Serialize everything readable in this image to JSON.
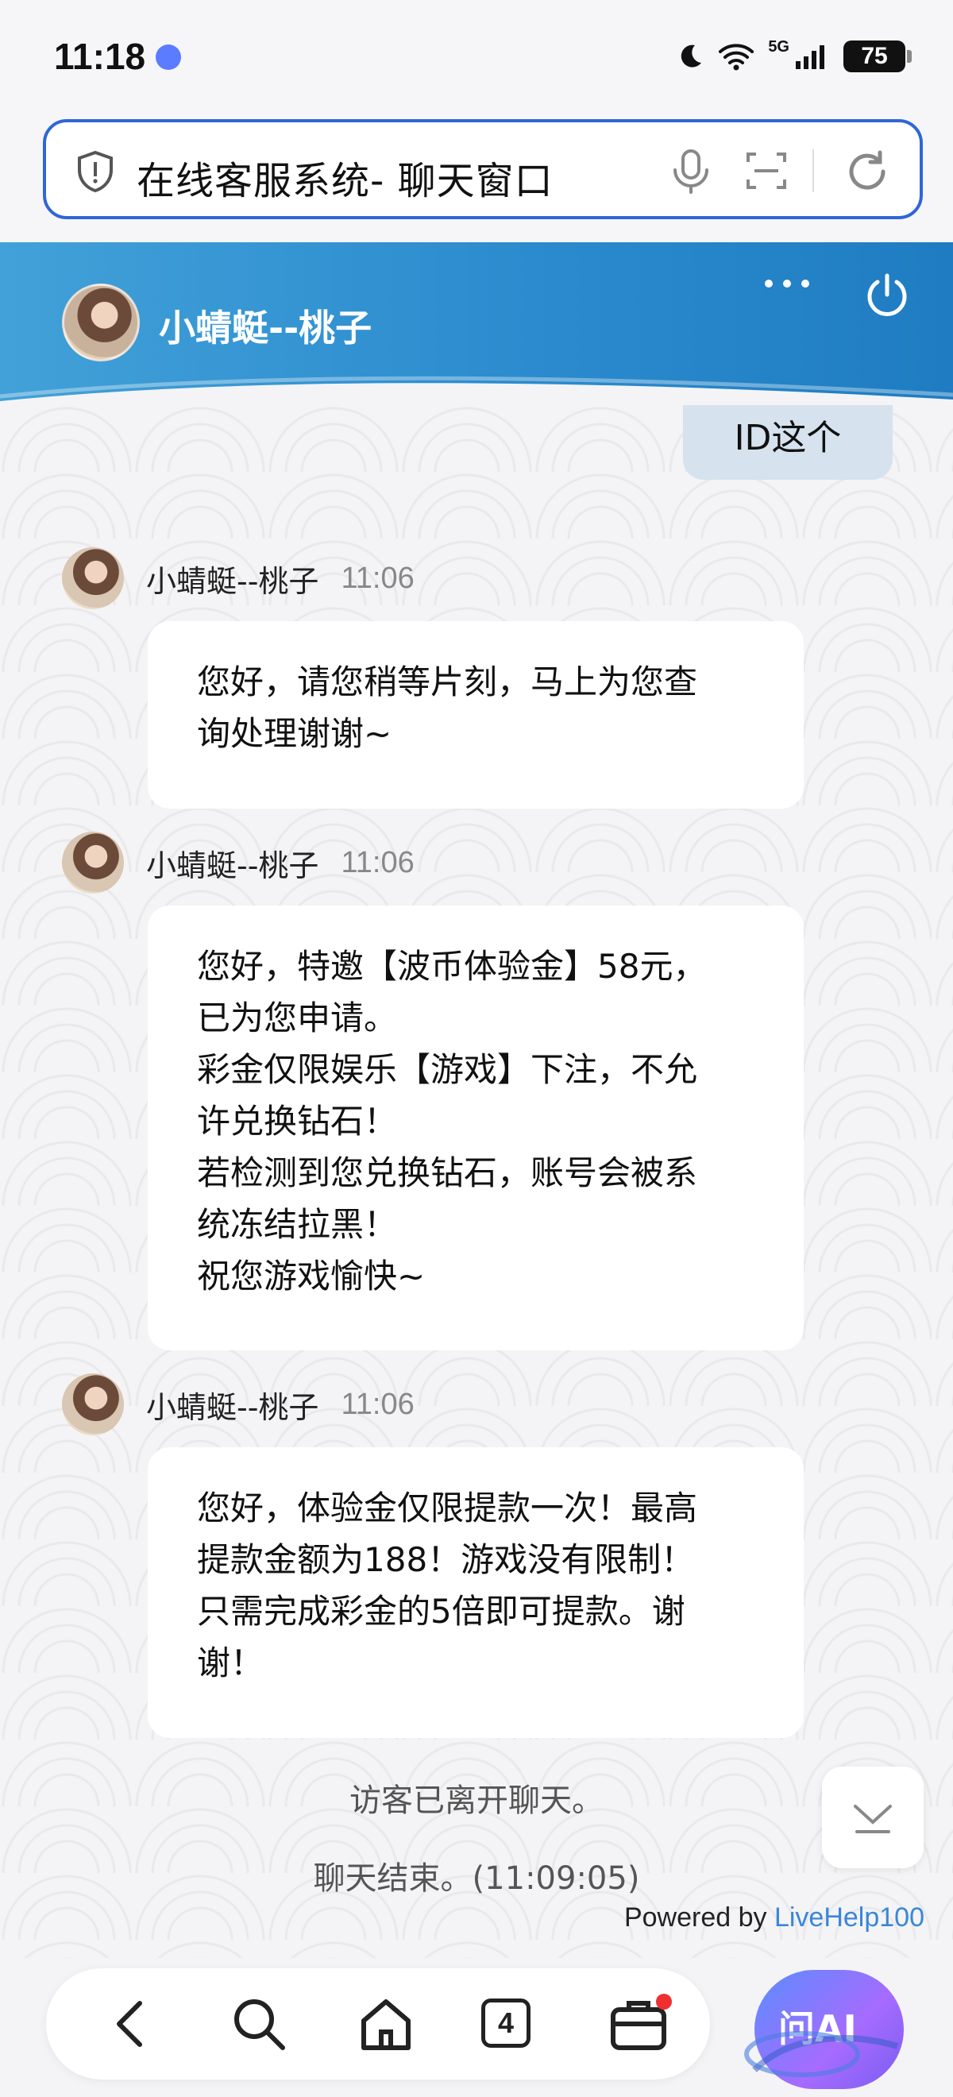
{
  "status_bar": {
    "time": "11:18",
    "battery": "75",
    "network": "5G",
    "icons": [
      "moon-icon",
      "wifi-icon",
      "signal-icon",
      "battery-icon"
    ]
  },
  "address_bar": {
    "title": "在线客服系统- 聊天窗口",
    "icons": [
      "shield-icon",
      "mic-icon",
      "scan-icon",
      "reload-icon"
    ]
  },
  "header": {
    "agent_name": "小蜻蜓--桃子",
    "icons": [
      "more-icon",
      "power-icon"
    ],
    "colors": {
      "start": "#42a1d8",
      "end": "#1f7cc2"
    }
  },
  "chat": {
    "self_message": "ID这个",
    "messages": [
      {
        "name": "小蜻蜓--桃子",
        "time": "11:06",
        "text": "您好，请您稍等片刻，马上为您查\n询处理谢谢~"
      },
      {
        "name": "小蜻蜓--桃子",
        "time": "11:06",
        "text": "您好，特邀【波币体验金】58元，\n已为您申请。\n彩金仅限娱乐【游戏】下注，不允\n许兑换钻石！\n若检测到您兑换钻石，账号会被系\n统冻结拉黑！\n祝您游戏愉快~"
      },
      {
        "name": "小蜻蜓--桃子",
        "time": "11:06",
        "text": "您好，体验金仅限提款一次！最高\n提款金额为188！游戏没有限制！\n只需完成彩金的5倍即可提款。谢\n谢！"
      }
    ],
    "system_left": "访客已离开聊天。",
    "system_end": "聊天结束。(11:09:05)",
    "powered_prefix": "Powered by ",
    "powered_brand": "LiveHelp100"
  },
  "bottom_nav": {
    "tab_count": "4",
    "ai_label": "问AI",
    "items": [
      "back-icon",
      "search-icon",
      "home-icon",
      "tabs-icon",
      "briefcase-icon"
    ]
  }
}
